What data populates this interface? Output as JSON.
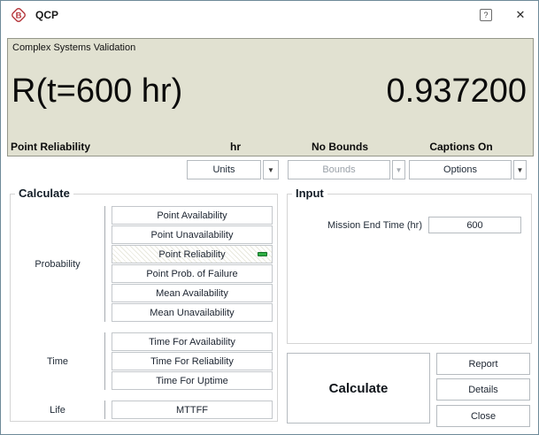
{
  "window": {
    "title": "QCP",
    "icon_letter": "B"
  },
  "titlebar": {
    "help_glyph": "?",
    "close_glyph": "✕"
  },
  "results": {
    "header": "Complex Systems Validation",
    "expression": "R(t=600 hr)",
    "value": "0.937200",
    "caption_metric": "Point Reliability",
    "caption_units": "hr",
    "caption_bounds": "No Bounds",
    "caption_captions": "Captions On"
  },
  "toolbar": {
    "units_label": "Units",
    "bounds_label": "Bounds",
    "options_label": "Options",
    "dropdown_arrow_glyph": "▼",
    "bounds_enabled": false
  },
  "calculate_box": {
    "title": "Calculate",
    "selected_button": "Point Reliability",
    "groups": [
      {
        "label": "Probability",
        "buttons": [
          "Point Availability",
          "Point Unavailability",
          "Point Reliability",
          "Point Prob. of Failure",
          "Mean Availability",
          "Mean Unavailability"
        ]
      },
      {
        "label": "Time",
        "buttons": [
          "Time For Availability",
          "Time For Reliability",
          "Time For Uptime"
        ]
      },
      {
        "label": "Life",
        "buttons": [
          "MTTFF"
        ]
      }
    ]
  },
  "input_box": {
    "title": "Input",
    "field_label": "Mission End Time (hr)",
    "field_value": "600"
  },
  "actions": {
    "calculate_label": "Calculate",
    "report_label": "Report",
    "details_label": "Details",
    "close_label": "Close"
  },
  "colors": {
    "results_bg": "#e1e1d1",
    "selected_indicator_green": "#2fae44",
    "window_border": "#6e8a99",
    "app_icon_red": "#b5373c",
    "disabled_text": "#9aa1a8"
  }
}
